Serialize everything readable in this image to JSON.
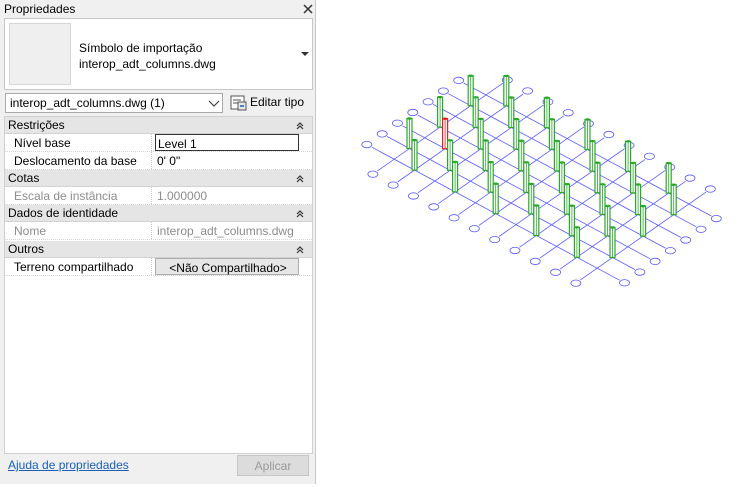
{
  "panel": {
    "title": "Propriedades",
    "type_selector": {
      "line1": "Símbolo de importação",
      "line2": "interop_adt_columns.dwg"
    },
    "instance_selector": "interop_adt_columns.dwg (1)",
    "edit_type_label": "Editar tipo",
    "categories": [
      {
        "label": "Restrições",
        "rows": [
          {
            "name": "Nível base",
            "value": "Level 1"
          },
          {
            "name": "Deslocamento da base",
            "value": "0'  0\""
          }
        ]
      },
      {
        "label": "Cotas",
        "rows": [
          {
            "name": "Escala de instância",
            "value": "1.000000"
          }
        ]
      },
      {
        "label": "Dados de identidade",
        "rows": [
          {
            "name": "Nome",
            "value": "interop_adt_columns.dwg"
          }
        ]
      },
      {
        "label": "Outros",
        "rows": [
          {
            "name": "Terreno compartilhado",
            "value": "<Não Compartilhado>"
          }
        ]
      }
    ],
    "help_link": "Ajuda de propriedades",
    "apply_label": "Aplicar"
  },
  "colors": {
    "grid_line": "#5a5aff",
    "column": "#2aa82a",
    "selected_column": "#e02020"
  },
  "icons": [
    "close-icon",
    "dropdown-arrow-icon",
    "chevron-down-icon",
    "edit-type-icon",
    "collapse-icon"
  ]
}
